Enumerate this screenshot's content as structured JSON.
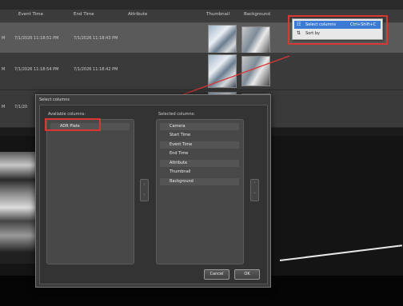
{
  "top_caption": "",
  "table": {
    "headers": [
      "Event Time",
      "End Time",
      "Attribute",
      "Thumbnail",
      "Background"
    ],
    "rows": [
      {
        "lead": "M",
        "event_time": "7/1/2026 11:18:51 PM",
        "end_time": "7/1/2026 11:18:43 PM"
      },
      {
        "lead": "M",
        "event_time": "7/1/2026 11:18:54 PM",
        "end_time": "7/1/2026 11:18:42 PM"
      },
      {
        "lead": "M",
        "event_time": "7/1/20",
        "end_time": ""
      }
    ]
  },
  "context_menu": {
    "items": [
      {
        "icon": "columns-icon",
        "glyph": "☷",
        "label": "Select columns",
        "shortcut": "Ctrl+Shift+C"
      },
      {
        "icon": "sort-icon",
        "glyph": "⇅",
        "label": "Sort by",
        "shortcut": ""
      }
    ]
  },
  "dialog": {
    "title": "Select columns",
    "available_label": "Available columns:",
    "selected_label": "Selected columns:",
    "available": [
      "ADR Plate"
    ],
    "selected": [
      "Camera",
      "Start Time",
      "Event Time",
      "End Time",
      "Attribute",
      "Thumbnail",
      "Background"
    ],
    "move_left_glyph": "‹",
    "move_right_glyph": "›",
    "move_up_glyph": "˄",
    "move_down_glyph": "˅",
    "cancel_label": "Cancel",
    "ok_label": "OK"
  },
  "colors": {
    "highlight_box": "#d93636",
    "menu_highlight": "#3b7bd6",
    "arrow": "#d93636"
  }
}
